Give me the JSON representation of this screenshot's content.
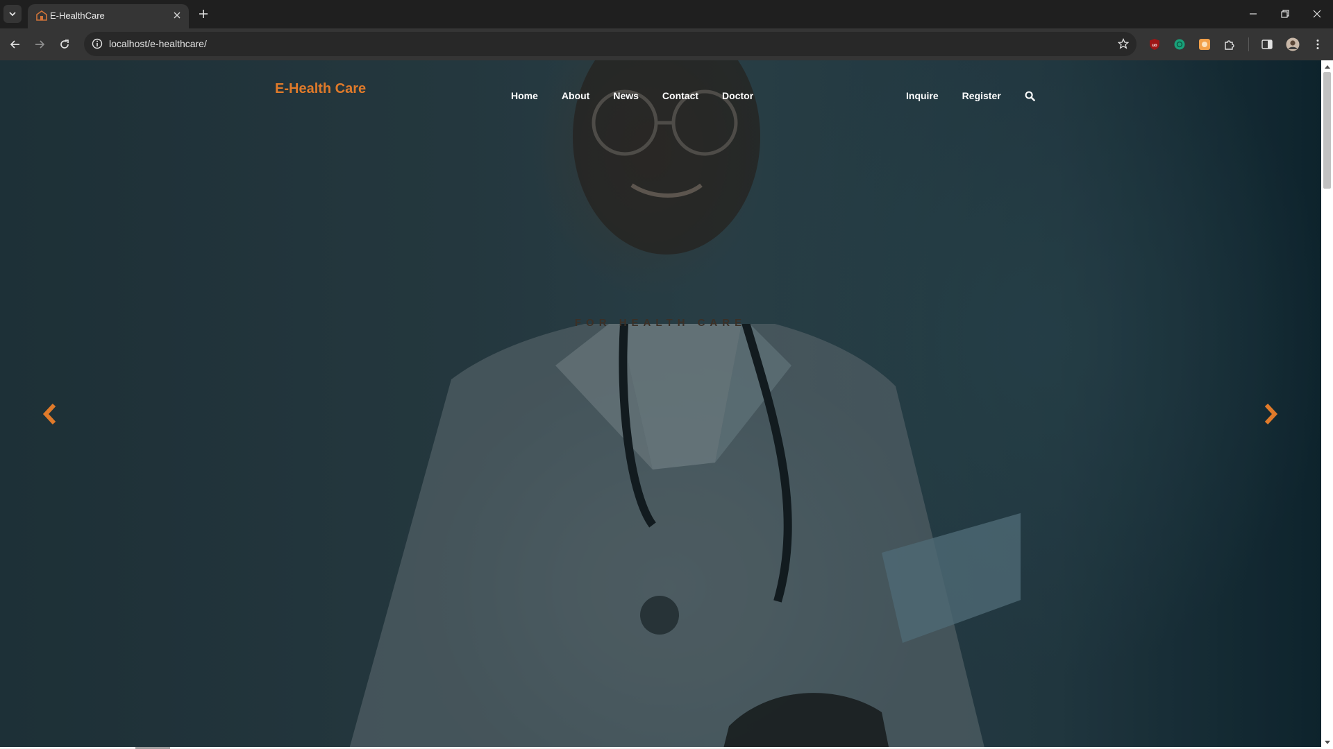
{
  "browser": {
    "tab_title": "E-HealthCare",
    "url": "localhost/e-healthcare/",
    "icons": [
      "tab-list-icon",
      "favicon-icon",
      "close-icon",
      "plus-icon",
      "minimize-icon",
      "restore-icon",
      "close-window-icon",
      "back-icon",
      "forward-icon",
      "reload-icon",
      "site-info-icon",
      "star-icon",
      "ublock-icon",
      "chatgpt-icon",
      "extension-orange-icon",
      "puzzle-icon",
      "side-panel-icon",
      "avatar",
      "kebab-menu-icon"
    ]
  },
  "site": {
    "brand": "E-Health Care",
    "nav": {
      "home": "Home",
      "about": "About",
      "news": "News",
      "contact": "Contact",
      "doctor": "Doctor"
    },
    "right_nav": {
      "inquire": "Inquire",
      "register": "Register"
    },
    "hero": {
      "tagline": "FOR HEALTH CARE"
    }
  },
  "colors": {
    "accent": "#e07a2a",
    "nav_text": "#ffffff",
    "hero_overlay": "#22343c"
  }
}
